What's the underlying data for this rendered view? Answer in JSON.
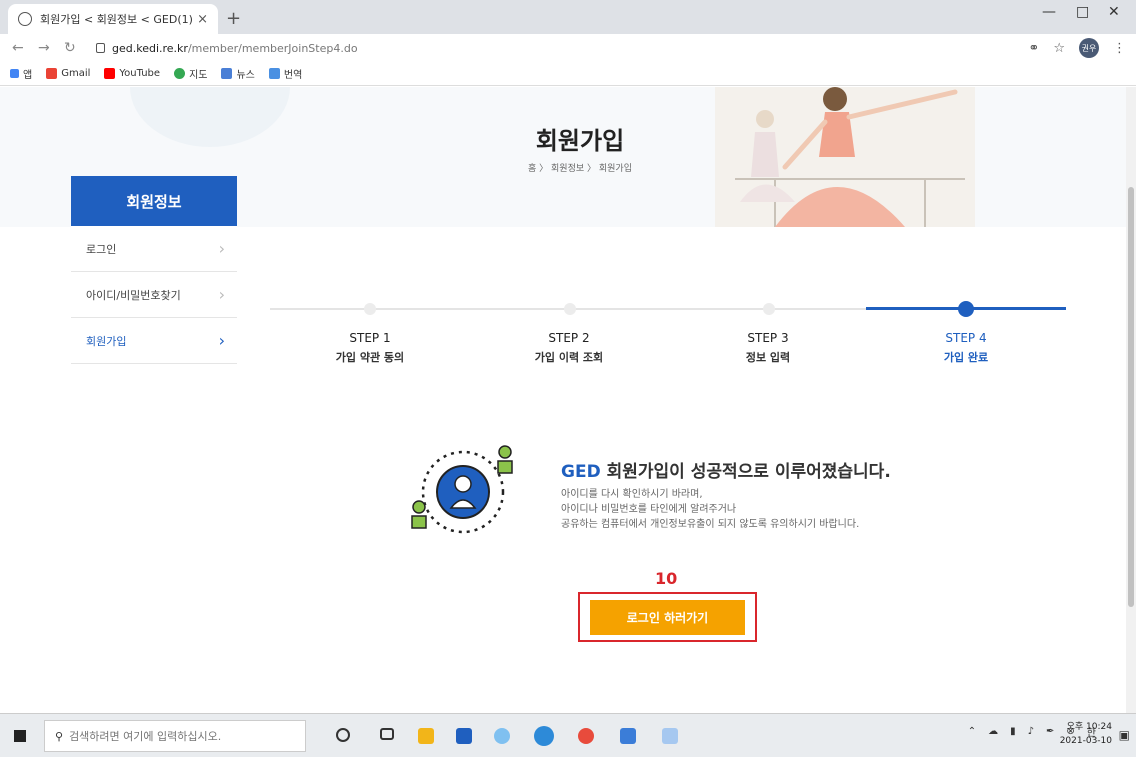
{
  "browser": {
    "tab_title": "회원가입 < 회원정보 < GED(1)",
    "tab_close": "×",
    "new_tab": "+",
    "url_host": "ged.kedi.re.kr",
    "url_path": "/member/memberJoinStep4.do",
    "avatar_text": "권우",
    "bookmarks": [
      "앱",
      "Gmail",
      "YouTube",
      "지도",
      "뉴스",
      "번역"
    ]
  },
  "hero": {
    "title": "회원가입",
    "breadcrumb": "홈 〉 회원정보 〉 회원가입"
  },
  "sidebar": {
    "header": "회원정보",
    "items": [
      {
        "label": "로그인"
      },
      {
        "label": "아이디/비밀번호찾기"
      },
      {
        "label": "회원가입"
      }
    ]
  },
  "steps": [
    {
      "label": "STEP 1",
      "sub": "가입 약관 동의"
    },
    {
      "label": "STEP 2",
      "sub": "가입 이력 조회"
    },
    {
      "label": "STEP 3",
      "sub": "정보 입력"
    },
    {
      "label": "STEP 4",
      "sub": "가입 완료"
    }
  ],
  "success": {
    "brand": "GED",
    "title_rest": " 회원가입이 성공적으로 이루어졌습니다.",
    "lines": [
      "아이디를 다시 확인하시기 바라며,",
      "아이디나 비밀번호를 타인에게 알려주거나",
      "공유하는 컴퓨터에서 개인정보유출이 되지 않도록 유의하시기 바랍니다."
    ]
  },
  "annotation": {
    "number": "10"
  },
  "login_button": "로그인 하러가기",
  "taskbar": {
    "search_placeholder": "검색하려면 여기에 입력하십시오.",
    "ime": "한",
    "time": "오후 10:24",
    "date": "2021-03-10"
  },
  "colors": {
    "primary": "#1f5fbf",
    "button": "#f5a200",
    "annotation": "#d9262c"
  }
}
